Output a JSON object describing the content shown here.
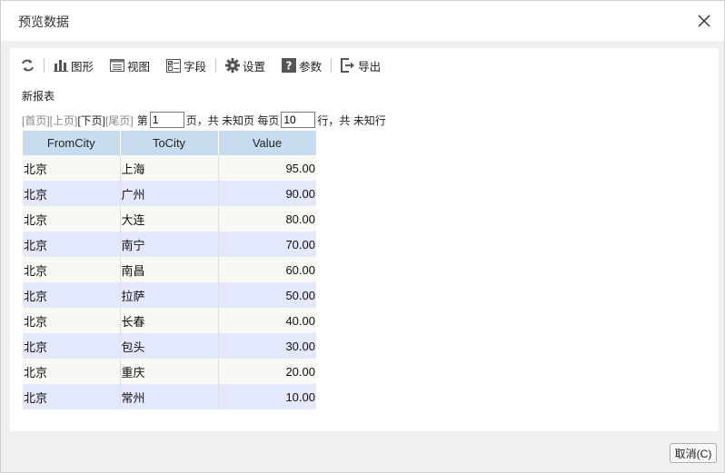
{
  "dialog": {
    "title": "预览数据",
    "cancel_label": "取消(C)"
  },
  "toolbar": {
    "items": [
      {
        "label": "图形",
        "icon": "bar-chart-icon"
      },
      {
        "label": "视图",
        "icon": "view-icon"
      },
      {
        "label": "字段",
        "icon": "field-icon"
      },
      {
        "label": "设置",
        "icon": "gear-icon"
      },
      {
        "label": "参数",
        "icon": "help-icon"
      },
      {
        "label": "导出",
        "icon": "export-icon"
      }
    ]
  },
  "report": {
    "title": "新报表"
  },
  "pager": {
    "first": "[首页]",
    "prev": "[上页]",
    "next": "[下页]",
    "last": "[尾页]",
    "page_prefix": "第",
    "page_value": "1",
    "page_suffix": "页，共 未知页 每页",
    "rows_per_page": "10",
    "rows_suffix": "行，共 未知行"
  },
  "table": {
    "columns": [
      "FromCity",
      "ToCity",
      "Value"
    ],
    "rows": [
      [
        "北京",
        "上海",
        "95.00"
      ],
      [
        "北京",
        "广州",
        "90.00"
      ],
      [
        "北京",
        "大连",
        "80.00"
      ],
      [
        "北京",
        "南宁",
        "70.00"
      ],
      [
        "北京",
        "南昌",
        "60.00"
      ],
      [
        "北京",
        "拉萨",
        "50.00"
      ],
      [
        "北京",
        "长春",
        "40.00"
      ],
      [
        "北京",
        "包头",
        "30.00"
      ],
      [
        "北京",
        "重庆",
        "20.00"
      ],
      [
        "北京",
        "常州",
        "10.00"
      ]
    ]
  },
  "colors": {
    "header_bg": "#c8dcf0",
    "row_odd_bg": "#f8f8f4",
    "row_even_bg": "#e4e8fc"
  }
}
